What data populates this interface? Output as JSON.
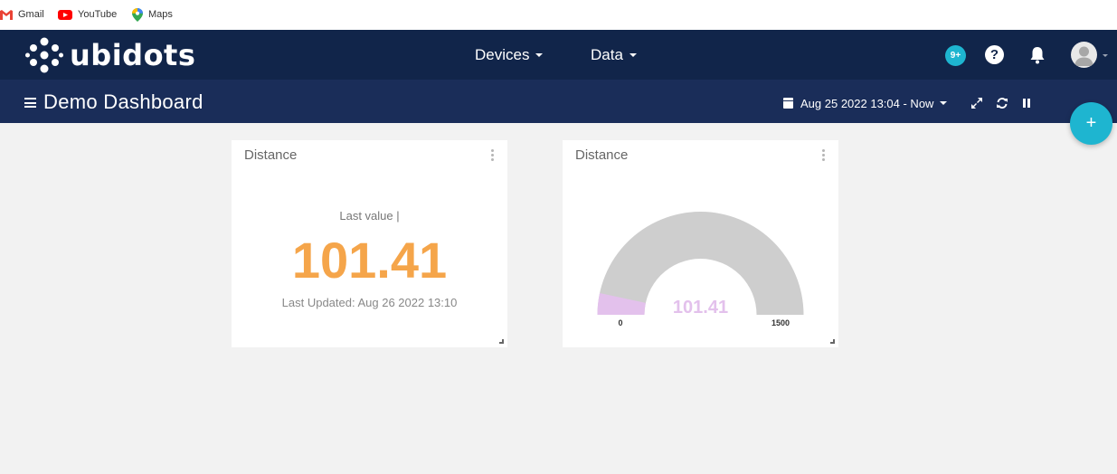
{
  "bookmarks": [
    {
      "label": "Gmail",
      "icon": "gmail-icon"
    },
    {
      "label": "YouTube",
      "icon": "youtube-icon"
    },
    {
      "label": "Maps",
      "icon": "maps-icon"
    }
  ],
  "navbar": {
    "logo": "ubidots",
    "menus": [
      {
        "label": "Devices"
      },
      {
        "label": "Data"
      }
    ],
    "notification_badge": "9+",
    "help_glyph": "?"
  },
  "dashboard": {
    "title": "Demo Dashboard",
    "date_range": "Aug 25 2022 13:04 - Now",
    "fab_glyph": "+"
  },
  "widgets": [
    {
      "type": "metric",
      "title": "Distance",
      "label": "Last value |",
      "value": "101.41",
      "updated": "Last Updated: Aug 26 2022 13:10",
      "value_color": "#f5a54a"
    },
    {
      "type": "gauge",
      "title": "Distance",
      "value": "101.41",
      "min": "0",
      "max": "1500",
      "fill_color": "#e3c1ec",
      "track_color": "#cecece"
    }
  ],
  "colors": {
    "navbar": "#11254a",
    "dashbar": "#1a2d59",
    "accent": "#1eb5d0",
    "background": "#f2f2f2"
  }
}
